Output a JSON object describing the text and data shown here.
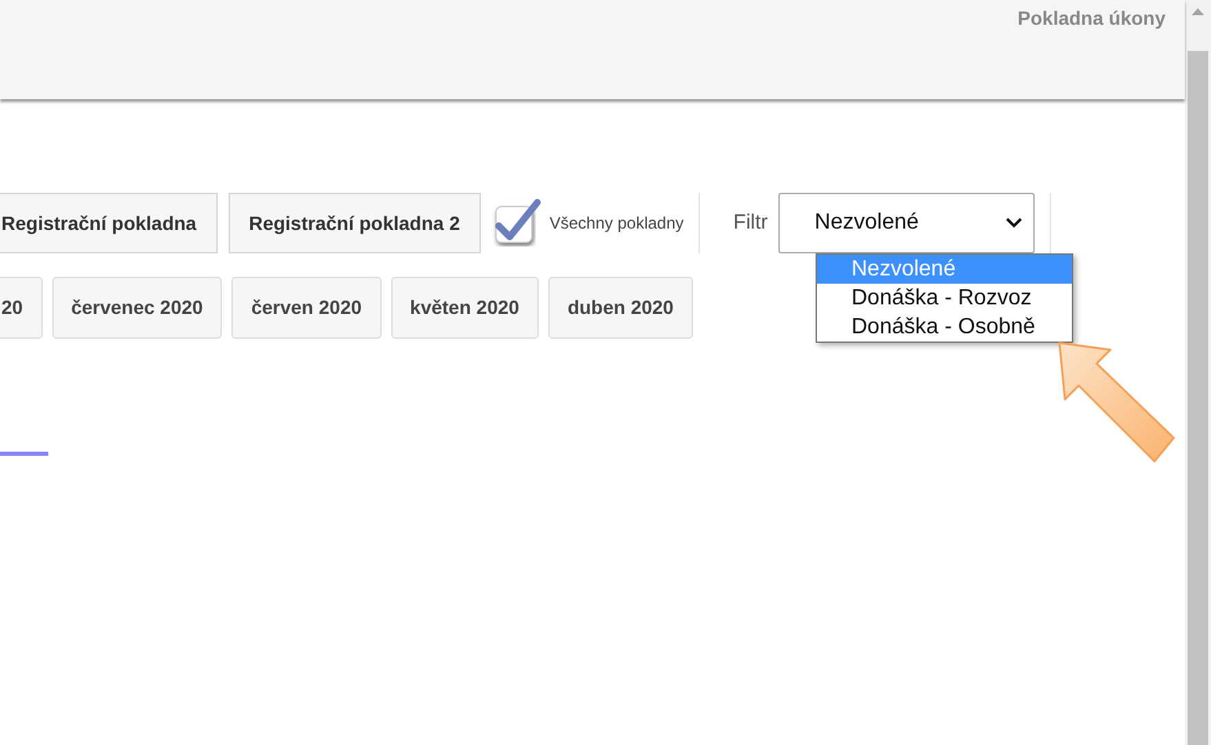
{
  "header": {
    "title": "Pokladna úkony"
  },
  "registers": [
    {
      "label": "Registrační pokladna"
    },
    {
      "label": "Registrační pokladna 2"
    }
  ],
  "all_registers": {
    "label": "Všechny pokladny",
    "checked": true
  },
  "filter": {
    "label": "Filtr",
    "value": "Nezvolené",
    "expanded": true,
    "options": [
      {
        "label": "Nezvolené",
        "selected": true
      },
      {
        "label": "Donáška - Rozvoz",
        "selected": false
      },
      {
        "label": "Donáška - Osobně",
        "selected": false
      }
    ]
  },
  "months": [
    {
      "label": "20"
    },
    {
      "label": "červenec 2020"
    },
    {
      "label": "červen 2020"
    },
    {
      "label": "květen 2020"
    },
    {
      "label": "duben 2020"
    }
  ]
}
